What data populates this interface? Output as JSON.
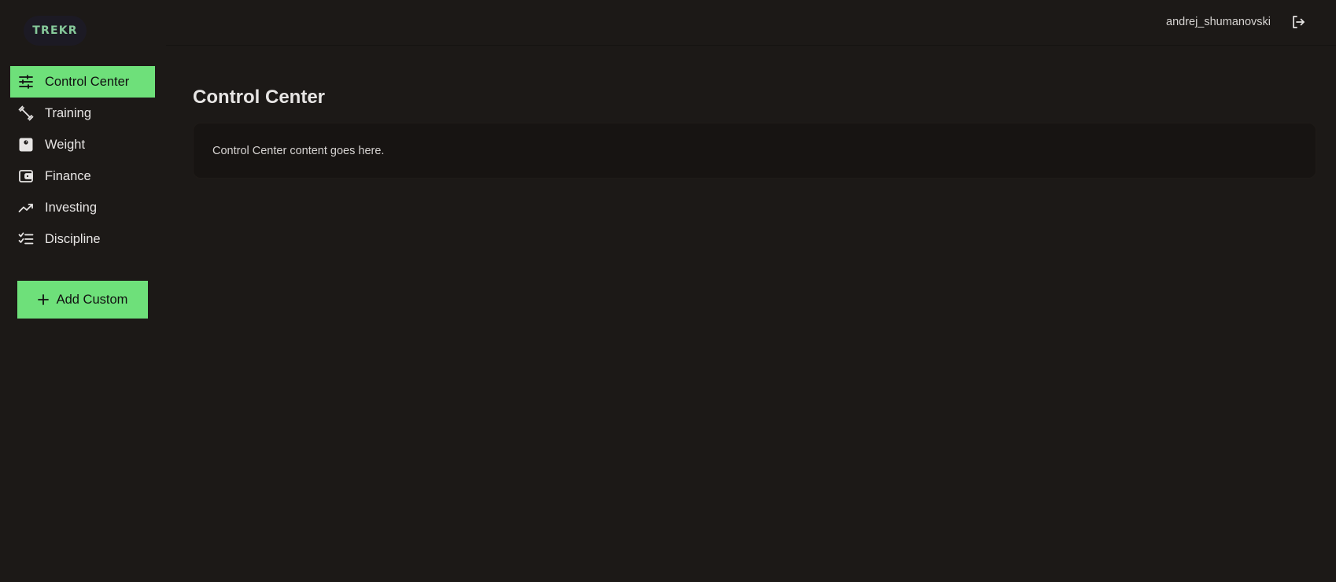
{
  "brand": {
    "logo_text": "TREKR"
  },
  "header": {
    "username": "andrej_shumanovski"
  },
  "sidebar": {
    "items": [
      {
        "label": "Control Center",
        "icon": "sliders-icon",
        "active": true
      },
      {
        "label": "Training",
        "icon": "dumbbell-icon",
        "active": false
      },
      {
        "label": "Weight",
        "icon": "scale-icon",
        "active": false
      },
      {
        "label": "Finance",
        "icon": "wallet-icon",
        "active": false
      },
      {
        "label": "Investing",
        "icon": "trending-up-icon",
        "active": false
      },
      {
        "label": "Discipline",
        "icon": "checklist-icon",
        "active": false
      }
    ],
    "add_button_label": "Add Custom"
  },
  "main": {
    "title": "Control Center",
    "content_text": "Control Center content goes here."
  },
  "colors": {
    "background": "#1c1917",
    "accent": "#6ee07a",
    "card": "#171412",
    "logo_text": "#86c99a"
  }
}
